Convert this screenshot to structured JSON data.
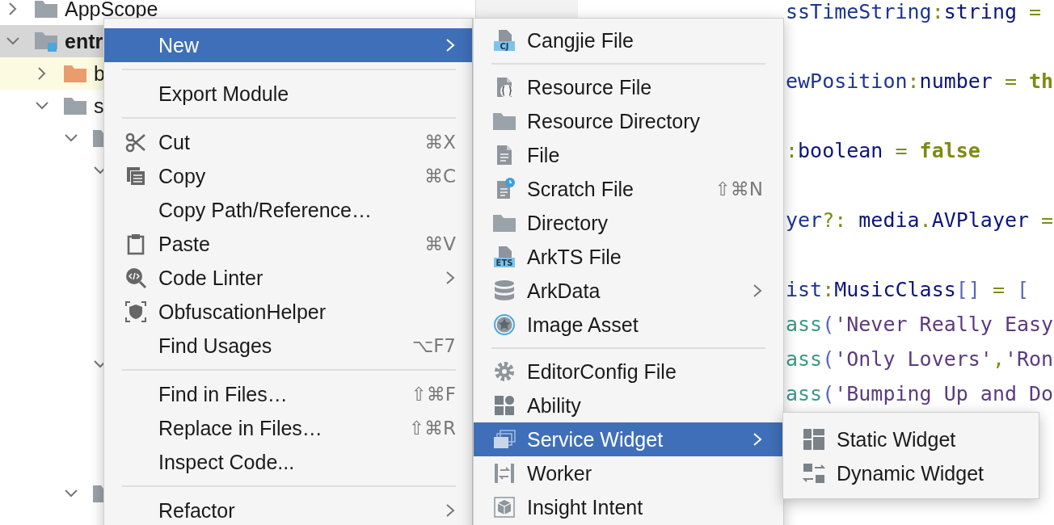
{
  "project_tree": [
    {
      "label": "AppScope",
      "kind": "folder",
      "expanded": false,
      "selected": false,
      "highlighted": false
    },
    {
      "label": "entr",
      "kind": "module",
      "expanded": true,
      "selected": true,
      "highlighted": false,
      "children": [
        {
          "label": "b",
          "kind": "output_folder",
          "expanded": false,
          "selected": false,
          "highlighted": true
        },
        {
          "label": "s",
          "kind": "folder",
          "expanded": true,
          "selected": false,
          "highlighted": false,
          "children": [
            {
              "kind": "folder",
              "expanded": true,
              "selected": false,
              "highlighted": false,
              "children": [
                {
                  "expanded": true,
                  "selected": false,
                  "highlighted": false
                },
                {
                  "expanded": true,
                  "selected": false,
                  "highlighted": false
                }
              ]
            },
            {
              "kind": "folder",
              "expanded": true,
              "selected": false,
              "highlighted": false
            }
          ]
        }
      ]
    }
  ],
  "editor": {
    "lines": [
      {
        "tokens": [
          {
            "kind": "ident",
            "text": "ssTimeString"
          },
          {
            "kind": "op",
            "text": ":"
          },
          {
            "kind": "type",
            "text": "string"
          },
          {
            "kind": "op",
            "text": " ="
          }
        ]
      },
      {
        "tokens": [
          {
            "kind": "ident",
            "text": "ewPosition"
          },
          {
            "kind": "op",
            "text": ":"
          },
          {
            "kind": "type",
            "text": "number"
          },
          {
            "kind": "op",
            "text": " = "
          },
          {
            "kind": "keyword",
            "text": "th"
          }
        ]
      },
      {
        "tokens": [
          {
            "kind": "op",
            "text": ":"
          },
          {
            "kind": "type",
            "text": "boolean"
          },
          {
            "kind": "op",
            "text": " = "
          },
          {
            "kind": "keyword",
            "text": "false"
          }
        ]
      },
      {
        "tokens": [
          {
            "kind": "ident",
            "text": "yer"
          },
          {
            "kind": "op",
            "text": "?: "
          },
          {
            "kind": "type",
            "text": "media"
          },
          {
            "kind": "op",
            "text": "."
          },
          {
            "kind": "type",
            "text": "AVPlayer"
          },
          {
            "kind": "op",
            "text": " ="
          }
        ]
      },
      {
        "tokens": [
          {
            "kind": "ident",
            "text": "ist"
          },
          {
            "kind": "op",
            "text": ":"
          },
          {
            "kind": "type",
            "text": "MusicClass"
          },
          {
            "kind": "bracket",
            "text": "[]"
          },
          {
            "kind": "op",
            "text": " = "
          },
          {
            "kind": "bracket",
            "text": "["
          }
        ]
      },
      {
        "tokens": [
          {
            "kind": "call",
            "text": "ass"
          },
          {
            "kind": "bracket",
            "text": "("
          },
          {
            "kind": "string",
            "text": "'Never Really Easy"
          }
        ]
      },
      {
        "tokens": [
          {
            "kind": "call",
            "text": "ass"
          },
          {
            "kind": "bracket",
            "text": "("
          },
          {
            "kind": "string",
            "text": "'Only Lovers'"
          },
          {
            "kind": "op",
            "text": ","
          },
          {
            "kind": "string",
            "text": "'Ron"
          }
        ]
      },
      {
        "tokens": [
          {
            "kind": "call",
            "text": "ass"
          },
          {
            "kind": "bracket",
            "text": "("
          },
          {
            "kind": "string",
            "text": "'Bumping Up and Do"
          }
        ]
      }
    ]
  },
  "menus": [
    {
      "items": [
        {
          "kind": "item",
          "label": "New",
          "submenu": true,
          "selected": true
        },
        {
          "kind": "separator"
        },
        {
          "kind": "item",
          "label": "Export Module",
          "submenu": false,
          "selected": false
        },
        {
          "kind": "separator"
        },
        {
          "kind": "item",
          "label": "Cut",
          "shortcut": "⌘X",
          "submenu": false,
          "selected": false
        },
        {
          "kind": "item",
          "label": "Copy",
          "shortcut": "⌘C",
          "submenu": false,
          "selected": false
        },
        {
          "kind": "item",
          "label": "Copy Path/Reference…",
          "submenu": false,
          "selected": false
        },
        {
          "kind": "item",
          "label": "Paste",
          "shortcut": "⌘V",
          "submenu": false,
          "selected": false
        },
        {
          "kind": "item",
          "label": "Code Linter",
          "submenu": true,
          "selected": false
        },
        {
          "kind": "item",
          "label": "ObfuscationHelper",
          "submenu": false,
          "selected": false
        },
        {
          "kind": "item",
          "label": "Find Usages",
          "shortcut": "⌥F7",
          "submenu": false,
          "selected": false
        },
        {
          "kind": "separator"
        },
        {
          "kind": "item",
          "label": "Find in Files…",
          "shortcut": "⇧⌘F",
          "submenu": false,
          "selected": false
        },
        {
          "kind": "item",
          "label": "Replace in Files…",
          "shortcut": "⇧⌘R",
          "submenu": false,
          "selected": false
        },
        {
          "kind": "item",
          "label": "Inspect Code...",
          "submenu": false,
          "selected": false
        },
        {
          "kind": "separator"
        },
        {
          "kind": "item",
          "label": "Refactor",
          "submenu": true,
          "selected": false
        }
      ]
    },
    {
      "items": [
        {
          "kind": "item",
          "label": "Cangjie File",
          "icon_badge": "CJ",
          "submenu": false,
          "selected": false
        },
        {
          "kind": "separator"
        },
        {
          "kind": "item",
          "label": "Resource File",
          "submenu": false,
          "selected": false
        },
        {
          "kind": "item",
          "label": "Resource Directory",
          "submenu": false,
          "selected": false
        },
        {
          "kind": "item",
          "label": "File",
          "submenu": false,
          "selected": false
        },
        {
          "kind": "item",
          "label": "Scratch File",
          "shortcut": "⇧⌘N",
          "submenu": false,
          "selected": false
        },
        {
          "kind": "item",
          "label": "Directory",
          "submenu": false,
          "selected": false
        },
        {
          "kind": "item",
          "label": "ArkTS File",
          "icon_badge": "ETS",
          "submenu": false,
          "selected": false
        },
        {
          "kind": "item",
          "label": "ArkData",
          "submenu": true,
          "selected": false
        },
        {
          "kind": "item",
          "label": "Image Asset",
          "submenu": false,
          "selected": false
        },
        {
          "kind": "separator"
        },
        {
          "kind": "item",
          "label": "EditorConfig File",
          "submenu": false,
          "selected": false
        },
        {
          "kind": "item",
          "label": "Ability",
          "submenu": false,
          "selected": false
        },
        {
          "kind": "item",
          "label": "Service Widget",
          "submenu": true,
          "selected": true
        },
        {
          "kind": "item",
          "label": "Worker",
          "submenu": false,
          "selected": false
        },
        {
          "kind": "item",
          "label": "Insight Intent",
          "submenu": false,
          "selected": false
        }
      ]
    },
    {
      "items": [
        {
          "kind": "item",
          "label": "Static Widget",
          "submenu": false,
          "selected": false
        },
        {
          "kind": "item",
          "label": "Dynamic Widget",
          "submenu": false,
          "selected": false
        }
      ]
    }
  ]
}
